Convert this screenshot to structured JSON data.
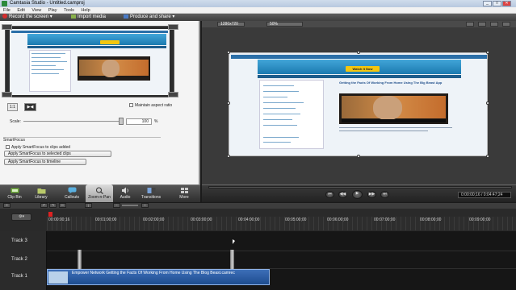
{
  "app": {
    "title": "Camtasia Studio - Untitled.camproj"
  },
  "window_controls": {
    "minimize": "_",
    "maximize": "□",
    "close": "✕"
  },
  "menu": [
    "File",
    "Edit",
    "View",
    "Play",
    "Tools",
    "Help"
  ],
  "toolbar": {
    "record_label": "Record the screen ▾",
    "import_label": "Import media",
    "produce_label": "Produce and share ▾"
  },
  "editor": {
    "maintain_aspect_label": "Maintain aspect ratio",
    "scale_label": "Scale:",
    "scale_value": "100",
    "scale_unit": "%",
    "smartfocus_heading": "SmartFocus",
    "smartfocus_check_label": "Apply SmartFocus to clips added",
    "apply_selected_label": "Apply SmartFocus to selected clips",
    "apply_timeline_label": "Apply SmartFocus to timeline"
  },
  "preview": {
    "resolution": "1280x720",
    "zoom": "50%",
    "site_button": "Watch It Now",
    "post_title": "Getting the Facts Of Working From Home Using The Big Beast App"
  },
  "tabs": [
    {
      "label": "Clip Bin",
      "icon": "film-icon"
    },
    {
      "label": "Library",
      "icon": "folder-icon"
    },
    {
      "label": "Callouts",
      "icon": "callout-icon"
    },
    {
      "label": "Zoom-n-Pan",
      "icon": "zoom-icon"
    },
    {
      "label": "Audio",
      "icon": "audio-icon"
    },
    {
      "label": "Transitions",
      "icon": "transitions-icon"
    },
    {
      "label": "More",
      "icon": "more-icon"
    }
  ],
  "player": {
    "time": "0:00:00;16 / 0:04:47;24"
  },
  "timeline": {
    "ticks": [
      "00:00:00;16",
      "00:01:00;00",
      "00:02:00;00",
      "00:03:00;00",
      "00:04:00;00",
      "00:05:00;00",
      "00:06:00;00",
      "00:07:00;00",
      "00:08:00;00",
      "00:09:00;00"
    ],
    "tracks": [
      "Track 3",
      "Track 2",
      "Track 1"
    ],
    "clip_label": "Empower Network    Getting the Facts Of Working From Home Using The Blog Beast.camrec"
  }
}
